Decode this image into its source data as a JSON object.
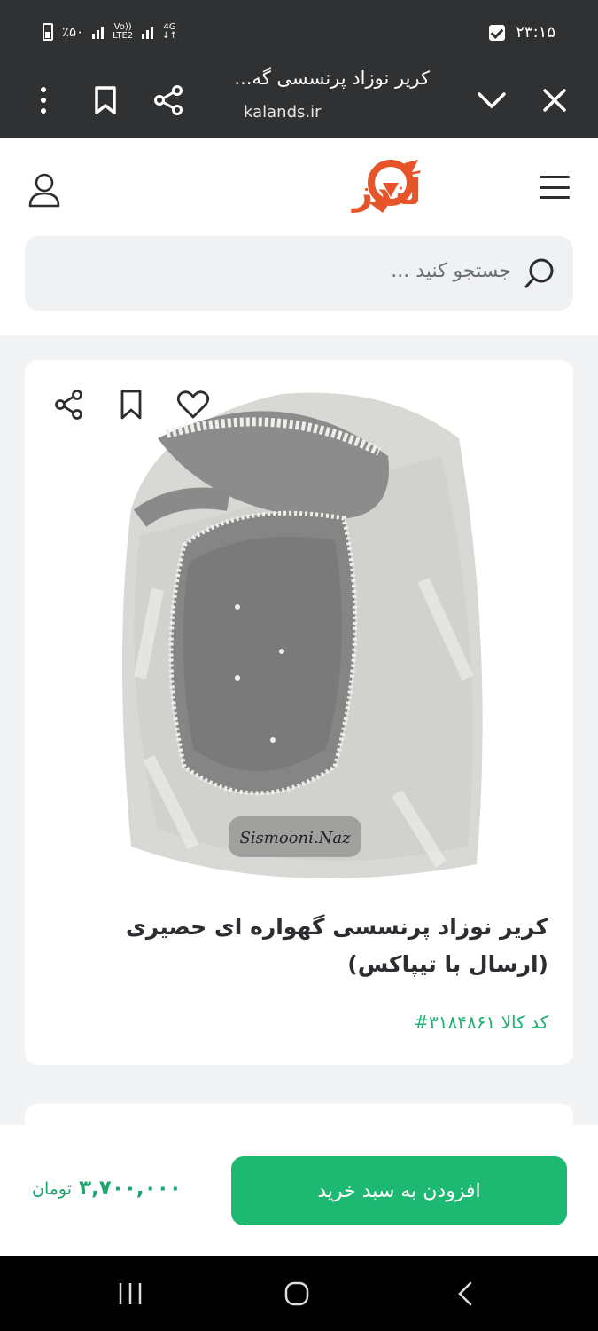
{
  "status_bar": {
    "time": "۲۳:۱۵",
    "battery": "٪۵۰",
    "volte_top": "Vo))",
    "volte_bottom": "LTE2",
    "network_top": "4G",
    "network_bottom": "↓↑"
  },
  "browser": {
    "title": "کریر نوزاد پرنسسی گه...",
    "url": "kalands.ir",
    "icons": [
      "more-vert-icon",
      "bookmark-icon",
      "share-icon",
      "chevron-down-icon",
      "close-icon"
    ]
  },
  "site": {
    "logo_text": "کالَندز",
    "search_placeholder": "جستجو کنید ...",
    "icons": [
      "user-icon",
      "menu-icon",
      "search-icon"
    ],
    "brand_color": "#e8542a"
  },
  "product": {
    "title": "کریر نوزاد پرنسسی گهواره ای حصیری (ارسال با تیپاکس)",
    "code": "کد کالا ۳۱۸۴۸۶۱#",
    "watermark": "Sismooni.Naz",
    "icons": [
      "share-icon",
      "bookmark-icon",
      "heart-icon"
    ]
  },
  "buy_bar": {
    "button_label": "افزودن به سبد خرید",
    "price": "۳,۷۰۰,۰۰۰",
    "currency": "تومان",
    "accent_color": "#1db872"
  },
  "nav": {
    "icons": [
      "recents-icon",
      "home-icon",
      "back-icon"
    ]
  }
}
